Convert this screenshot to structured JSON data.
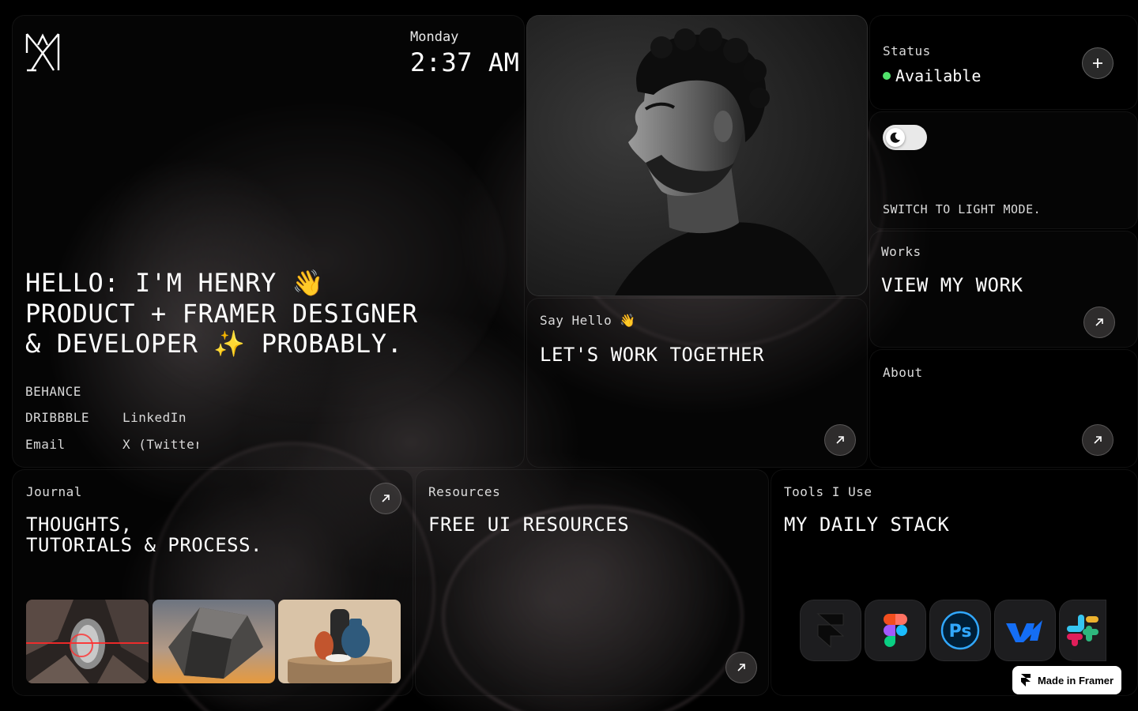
{
  "hero": {
    "day": "Monday",
    "time": "2:37 AM",
    "headline": "HELLO: I'M HENRY 👋\nPRODUCT + FRAMER DESIGNER\n& DEVELOPER ✨ PROBABLY.",
    "links": [
      "BEHANCE",
      "DRIBBBLE",
      "LinkedIn",
      "Email",
      "X (Twitter"
    ]
  },
  "say_hello": {
    "label": "Say Hello 👋",
    "title": "LET'S WORK TOGETHER"
  },
  "status": {
    "label": "Status",
    "value": "Available",
    "dot_color": "#51e26b"
  },
  "theme": {
    "label": "SWITCH TO LIGHT MODE.",
    "toggle_state": "dark"
  },
  "works": {
    "label": "Works",
    "title": "VIEW MY WORK"
  },
  "about": {
    "label": "About"
  },
  "journal": {
    "label": "Journal",
    "title": "THOUGHTS,\nTUTORIALS & PROCESS."
  },
  "resources": {
    "label": "Resources",
    "title": "FREE UI RESOURCES"
  },
  "tools": {
    "label": "Tools I Use",
    "title": "MY DAILY STACK",
    "items": [
      "framer-icon",
      "figma-icon",
      "photoshop-icon",
      "webflow-icon",
      "slack-icon"
    ]
  },
  "badge": {
    "label": "Made in Framer"
  }
}
